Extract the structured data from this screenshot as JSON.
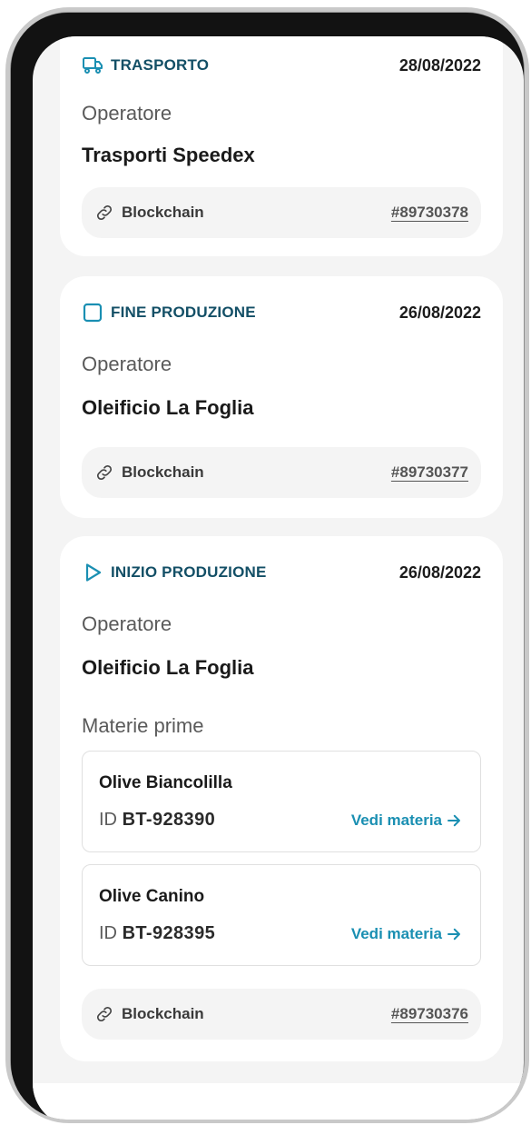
{
  "colors": {
    "accent": "#1a8fb2",
    "stage_label": "#134f66",
    "screen_bg": "#f4f4f4",
    "card_bg": "#ffffff"
  },
  "events": [
    {
      "stage_icon": "truck-icon",
      "stage": "TRASPORTO",
      "date": "28/08/2022",
      "operator_label": "Operatore",
      "operator": "Trasporti Speedex",
      "blockchain_label": "Blockchain",
      "blockchain_hash": "#89730378"
    },
    {
      "stage_icon": "square-stop-icon",
      "stage": "FINE PRODUZIONE",
      "date": "26/08/2022",
      "operator_label": "Operatore",
      "operator": "Oleificio La Foglia",
      "blockchain_label": "Blockchain",
      "blockchain_hash": "#89730377"
    },
    {
      "stage_icon": "play-icon",
      "stage": "INIZIO PRODUZIONE",
      "date": "26/08/2022",
      "operator_label": "Operatore",
      "operator": "Oleificio La Foglia",
      "materials_title": "Materie prime",
      "materials": [
        {
          "name": "Olive Biancolilla",
          "id_prefix": "ID",
          "id": "BT-928390",
          "link_label": "Vedi materia"
        },
        {
          "name": "Olive Canino",
          "id_prefix": "ID",
          "id": "BT-928395",
          "link_label": "Vedi materia"
        }
      ],
      "blockchain_label": "Blockchain",
      "blockchain_hash": "#89730376"
    }
  ]
}
